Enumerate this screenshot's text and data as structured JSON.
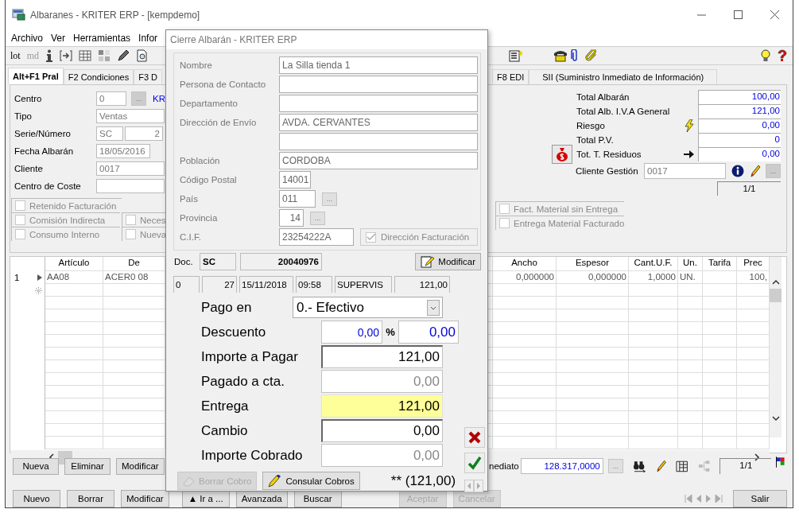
{
  "window": {
    "title": "Albaranes - KRITER ERP -  [kempdemo]"
  },
  "menu": [
    "Archivo",
    "Ver",
    "Herramientas",
    "Infor"
  ],
  "toolbar": [
    {
      "text": "lot",
      "disabled": false
    },
    {
      "text": "md",
      "disabled": true
    }
  ],
  "tabs": [
    {
      "label": "Alt+F1 Pral",
      "selected": true
    },
    {
      "label": "F2 Condiciones",
      "selected": false
    },
    {
      "label": "F3 D",
      "selected": false
    },
    {
      "label": "F8 EDI",
      "selected": false
    },
    {
      "label": "SII (Suministro Inmediato de Información)",
      "selected": false
    }
  ],
  "header": {
    "fields": [
      {
        "label": "Centro",
        "kind": "lookup",
        "value": "0",
        "button": "...",
        "link": "KR"
      },
      {
        "label": "Tipo",
        "kind": "text",
        "value": "Ventas"
      },
      {
        "label": "Serie/Número",
        "kind": "pair",
        "value": "SC",
        "number": "2"
      },
      {
        "label": "Fecha Albarán",
        "kind": "date",
        "value": "18/05/2016"
      },
      {
        "label": "Cliente",
        "kind": "text",
        "value": "0017"
      },
      {
        "label": "Centro de Coste",
        "kind": "text"
      }
    ],
    "options_left": [
      [
        {
          "label": "Retenido Facturación",
          "checked": false,
          "disabled": true
        }
      ],
      [
        {
          "label": "Comisión Indirecta",
          "checked": false,
          "disabled": true
        },
        {
          "label": "Neces",
          "checked": false,
          "disabled": true
        }
      ],
      [
        {
          "label": "Consumo Interno",
          "checked": false,
          "disabled": true
        },
        {
          "label": "Nueva",
          "checked": false,
          "disabled": true
        }
      ]
    ],
    "totals": [
      {
        "label": "Total Albarán",
        "value": "100,00",
        "kind": "plain"
      },
      {
        "label": "Total Alb. I.V.A General",
        "value": "121,00",
        "kind": "plain"
      },
      {
        "label": "Riesgo",
        "value": "0,00",
        "kind": "risk"
      },
      {
        "label": "Total P.V.",
        "value": "0",
        "kind": "plain"
      },
      {
        "label": "Tot. T. Residuos",
        "value": "0,00",
        "kind": "waste"
      }
    ],
    "client": {
      "label": "Cliente Gestión",
      "value": "0017",
      "button": "..."
    },
    "pager": "1/1",
    "options_right": [
      {
        "label": "Fact. Material sin Entrega",
        "checked": false,
        "disabled": true
      },
      {
        "label": "Entrega Material Facturado",
        "checked": false,
        "disabled": true
      }
    ]
  },
  "grid": {
    "columns_left": [
      "Artículo",
      "De"
    ],
    "columns_right": [
      "Ancho",
      "Espesor",
      "Cant.U.F.",
      "Un.",
      "Tarifa",
      "Prec"
    ],
    "rows": [
      {
        "number": "1",
        "current": true,
        "articulo": "AA08",
        "descripcion": "ACER0 08",
        "ancho": "0,000000",
        "espesor": "0,000000",
        "cant_uf": "1,0000",
        "un": "UN.",
        "precio": "100,"
      }
    ]
  },
  "grid_buttons": [
    {
      "label": "Nueva",
      "disabled": false
    },
    {
      "label": "Eliminar",
      "disabled": false
    },
    {
      "label": "Modificar",
      "disabled": false
    }
  ],
  "grid_footer": {
    "label": "nediato",
    "value": "128.317,0000",
    "button": "...",
    "pager": "1/1"
  },
  "buttons": [
    {
      "label": "Nuevo",
      "disabled": false
    },
    {
      "label": "Borrar",
      "disabled": false
    },
    {
      "label": "Modificar",
      "disabled": false
    },
    {
      "label": "▲ Ir a ...",
      "disabled": false
    },
    {
      "label": "Avanzada",
      "disabled": false
    },
    {
      "label": "Buscar",
      "disabled": false
    },
    {
      "label": "Aceptar",
      "disabled": true
    },
    {
      "label": "Cancelar",
      "disabled": true
    }
  ],
  "exit_button": {
    "label": "Salir",
    "disabled": false
  },
  "dialog": {
    "title": "Cierre Albarán - KRITER ERP",
    "fields": [
      {
        "label": "Nombre",
        "kind": "wide",
        "value": "La Silla tienda 1"
      },
      {
        "label": "Persona de Contacto",
        "kind": "wide"
      },
      {
        "label": "Departamento",
        "kind": "wide"
      },
      {
        "label": "Dirección de Envío",
        "kind": "wide",
        "value": "AVDA. CERVANTES"
      },
      {
        "kind": "wide"
      },
      {
        "label": "Población",
        "kind": "wide",
        "value": "CORDOBA"
      },
      {
        "label": "Código Postal",
        "kind": "postal",
        "value": "14001"
      },
      {
        "label": "País",
        "kind": "country",
        "value": "011",
        "button": "..."
      },
      {
        "label": "Provincia",
        "kind": "province",
        "value": "14",
        "button": "..."
      },
      {
        "label": "C.I.F.",
        "kind": "cif",
        "value": "23254222A"
      }
    ],
    "billing_address": {
      "label": "Dirección Facturación",
      "checked": true,
      "disabled": true
    },
    "doc": {
      "label": "Doc.",
      "series": "SC",
      "number": "20040976"
    },
    "edit_button": {
      "label": "Modificar",
      "disabled": false
    },
    "info": [
      "0",
      "27",
      "15/11/2018",
      "09:58",
      "SUPERVIS",
      "121,00"
    ],
    "payment": {
      "label": "Pago en",
      "value": "0.- Efectivo"
    },
    "discount": {
      "label": "Descuento",
      "percent": "0,00",
      "symbol": "%",
      "value": "0,00"
    },
    "amounts": [
      {
        "label": "Importe a Pagar",
        "value": "121,00",
        "disabled": false,
        "focused": false
      },
      {
        "label": "Pagado a cta.",
        "value": "0,00",
        "disabled": true,
        "focused": false
      },
      {
        "label": "Entrega",
        "value": "121,00",
        "disabled": false,
        "focused": true
      },
      {
        "label": "Cambio",
        "value": "0,00",
        "disabled": false,
        "focused": false
      },
      {
        "label": "Importe Cobrado",
        "value": "0,00",
        "disabled": true,
        "focused": false
      }
    ],
    "delete_button": {
      "label": "Borrar Cobro",
      "disabled": true
    },
    "query_button": {
      "label": "Consular Cobros",
      "disabled": false
    },
    "summary": "** (121,00)"
  }
}
